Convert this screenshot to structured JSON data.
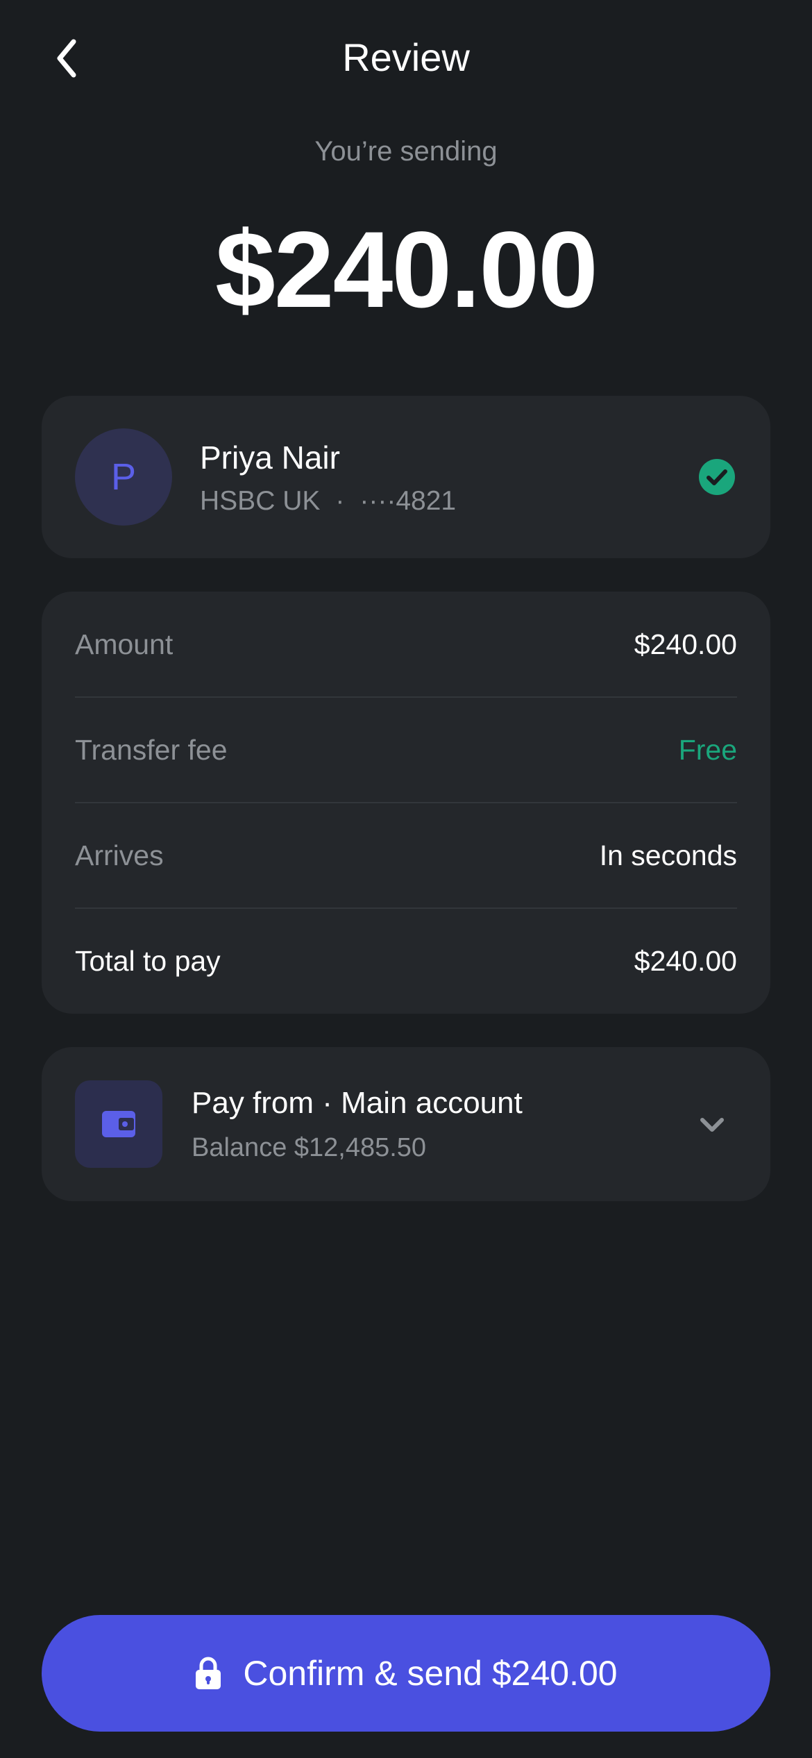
{
  "header": {
    "title": "Review",
    "back_icon": "chevron-left-icon"
  },
  "transfer": {
    "sending_label": "You’re sending",
    "amount": "$240.00"
  },
  "recipient": {
    "initial": "P",
    "name": "Priya Nair",
    "bank": "HSBC UK",
    "separator": "·",
    "account_masked": "····4821",
    "verified_icon": "check-circle-icon"
  },
  "summary": {
    "rows": [
      {
        "label": "Amount",
        "value": "$240.00"
      },
      {
        "label": "Transfer fee",
        "value": "Free"
      },
      {
        "label": "Arrives",
        "value": "In seconds"
      },
      {
        "label": "Total to pay",
        "value": "$240.00"
      }
    ]
  },
  "pay_from": {
    "title": "Pay from · Main account",
    "balance": "Balance $12,485.50",
    "icon": "wallet-icon",
    "chevron_icon": "chevron-down-icon"
  },
  "confirm": {
    "label": "Confirm & send $240.00",
    "icon": "lock-icon"
  },
  "colors": {
    "background": "#1a1d20",
    "card": "#24272b",
    "accent": "#4a50e0",
    "success": "#1aa67c",
    "muted_text": "#8d9196"
  }
}
